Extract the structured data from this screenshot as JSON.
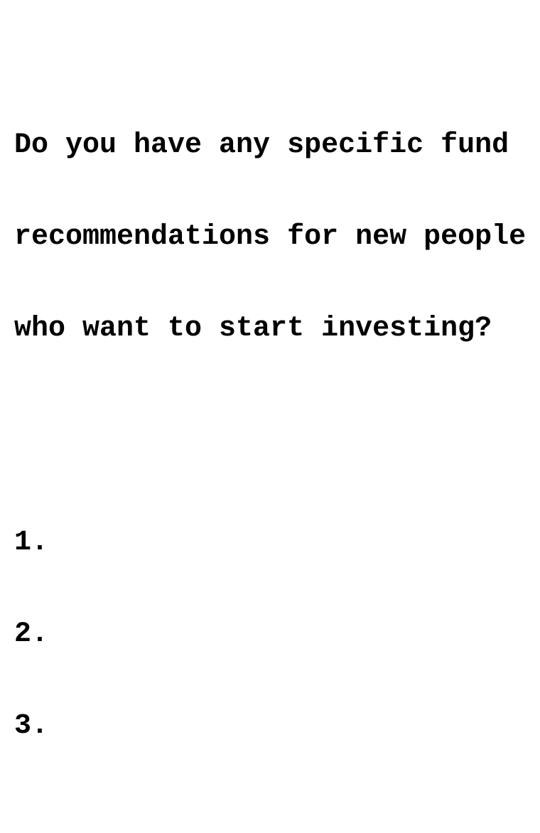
{
  "document": {
    "question_lines": [
      "Do you have any specific fund",
      "recommendations for new people",
      "who want to start investing?"
    ],
    "list_items": [
      "1.",
      "2.",
      "3."
    ]
  },
  "colors": {
    "background": "#ffffff",
    "text": "#000000"
  }
}
